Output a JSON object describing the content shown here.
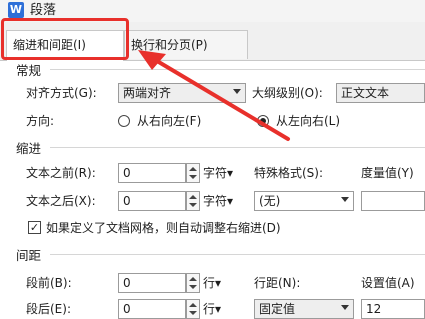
{
  "window": {
    "icon_letter": "W",
    "title": "段落"
  },
  "tabs": [
    {
      "label": "缩进和间距(I)",
      "active": true
    },
    {
      "label": "换行和分页(P)",
      "active": false
    }
  ],
  "general": {
    "section_title": "常规",
    "alignment_label": "对齐方式(G):",
    "alignment_value": "两端对齐",
    "outline_label": "大纲级别(O):",
    "outline_value": "正文文本",
    "direction_label": "方向:",
    "rtl_label": "从右向左(F)",
    "ltr_label": "从左向右(L)",
    "selected_direction": "ltr"
  },
  "indent": {
    "section_title": "缩进",
    "before_label": "文本之前(R):",
    "before_value": "0",
    "before_unit": "字符▾",
    "after_label": "文本之后(X):",
    "after_value": "0",
    "after_unit": "字符▾",
    "special_label": "特殊格式(S):",
    "special_value": "(无)",
    "measure_label": "度量值(Y)",
    "grid_checkbox_label": "如果定义了文档网格，则自动调整右缩进(D)",
    "grid_checkbox_checked": true
  },
  "spacing": {
    "section_title": "间距",
    "before_label": "段前(B):",
    "before_value": "0",
    "before_unit": "行▾",
    "after_label": "段后(E):",
    "after_value": "0",
    "after_unit": "行▾",
    "line_label": "行距(N):",
    "line_value": "固定值",
    "setting_label": "设置值(A)",
    "setting_value": "12"
  },
  "colors": {
    "annotation_red": "#e8302b"
  },
  "annotation": {
    "shape": "red-rounded-rectangle-with-arrow"
  }
}
